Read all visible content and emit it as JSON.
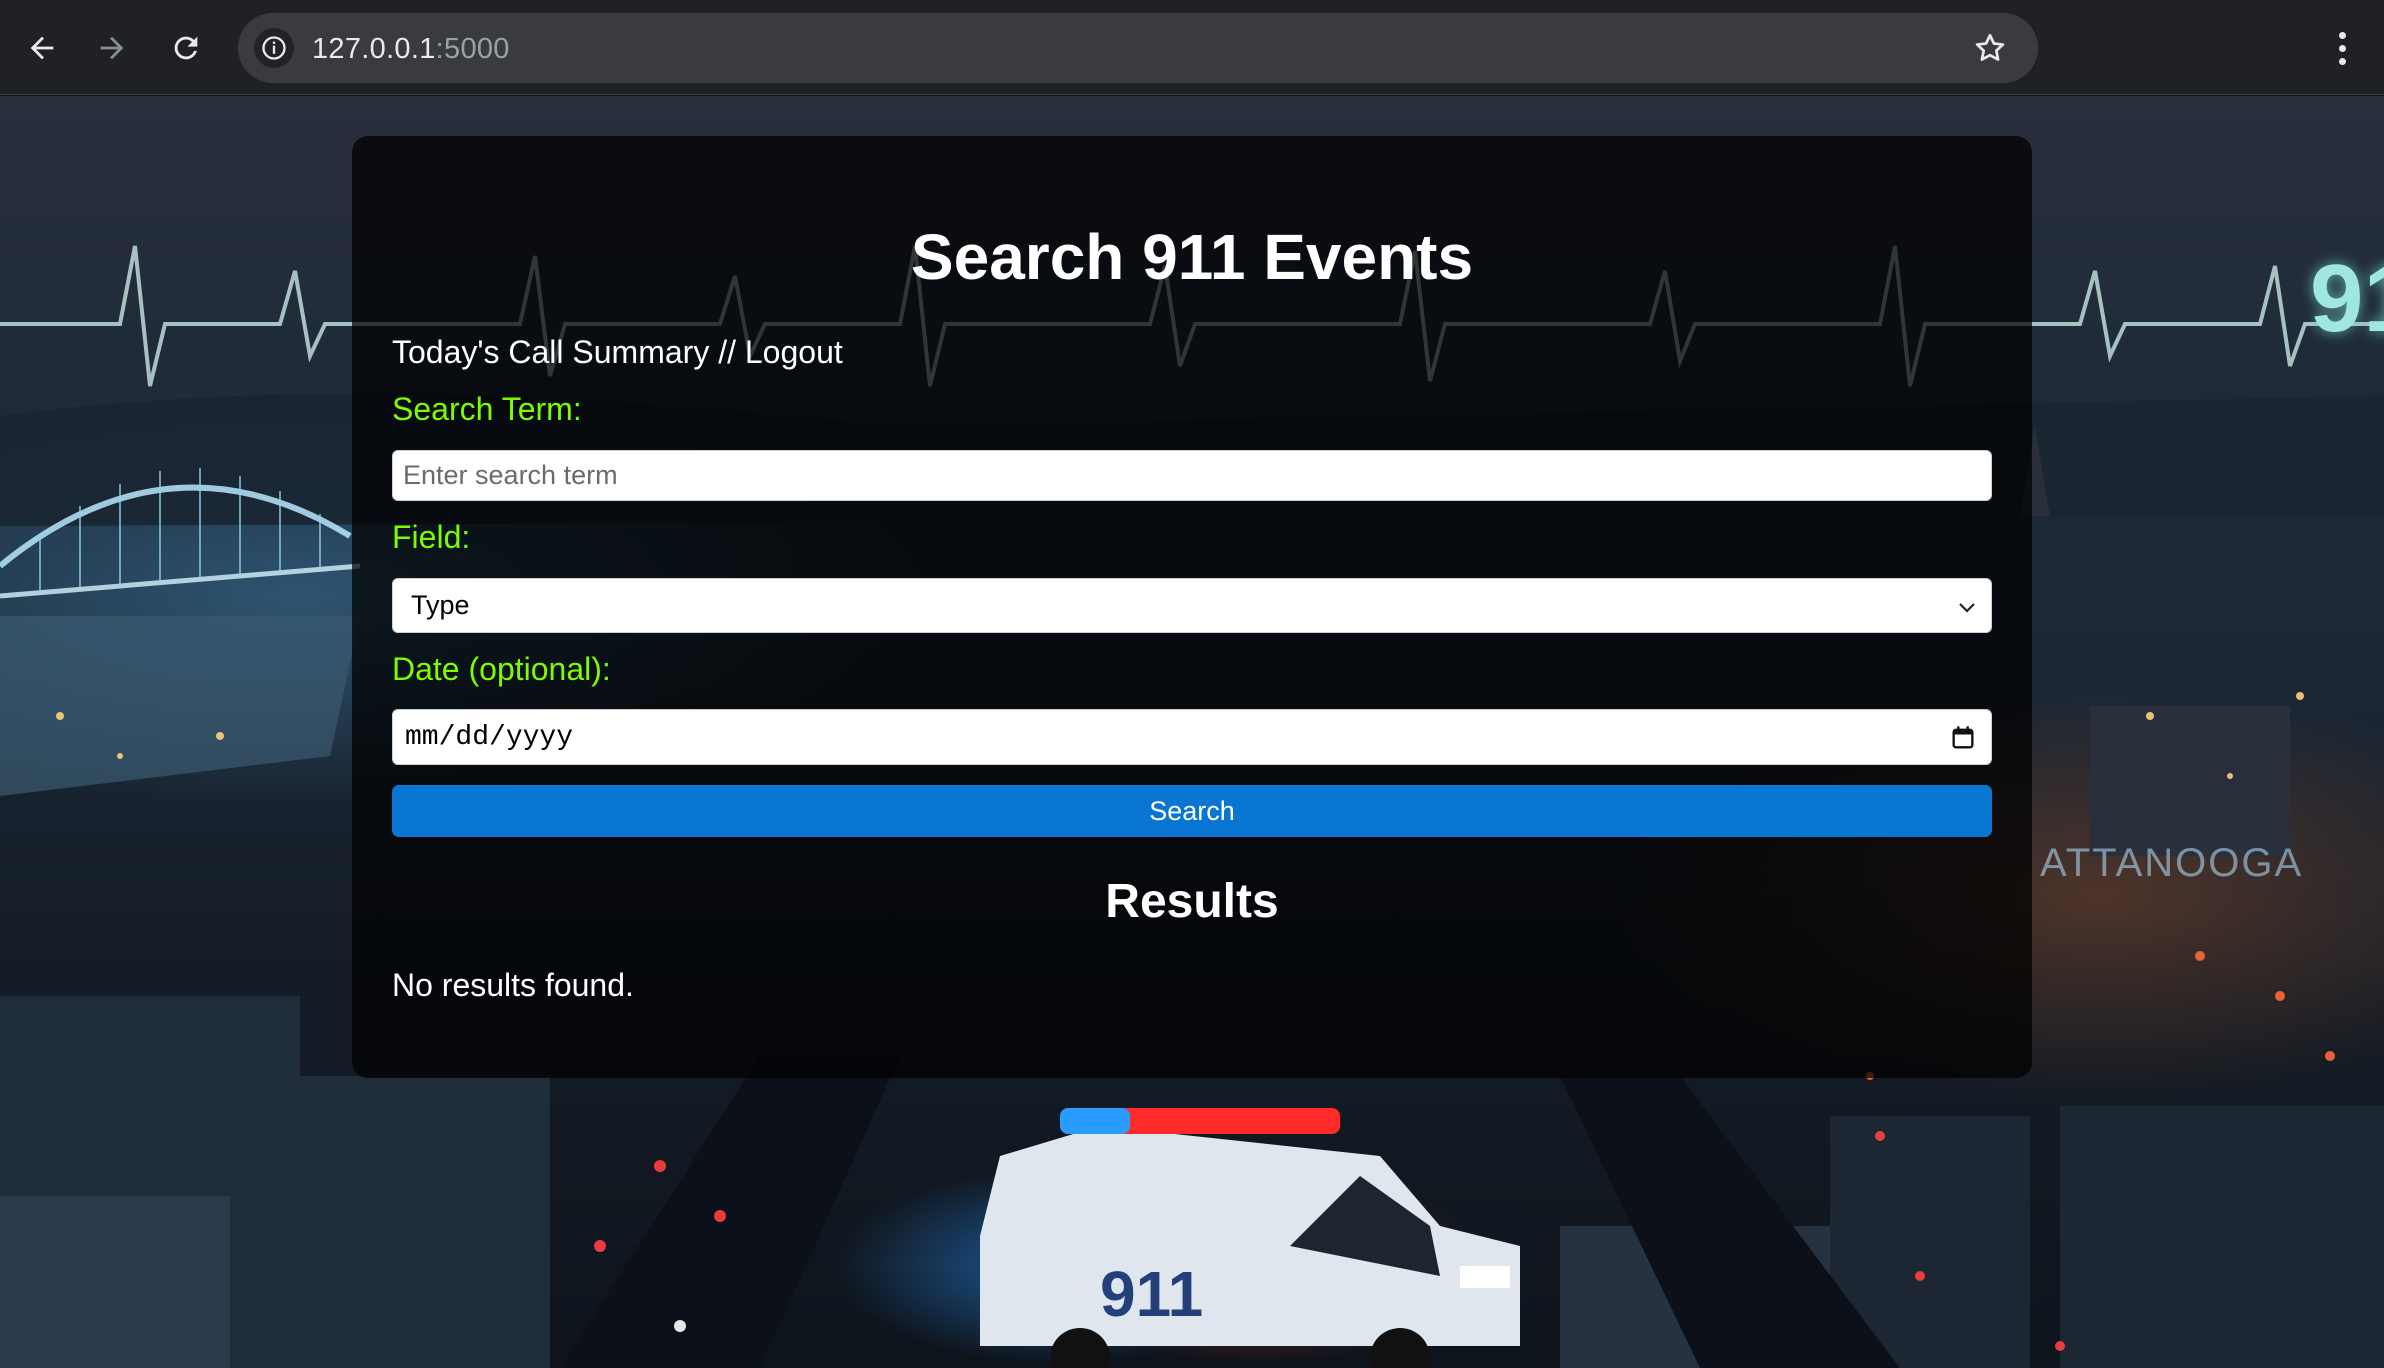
{
  "browser": {
    "url_host": "127.0.0.1",
    "url_port": ":5000"
  },
  "background": {
    "corner_text": "91",
    "city_sign": "ATTANOOGA"
  },
  "page": {
    "title": "Search 911 Events",
    "links": {
      "summary": "Today's Call Summary",
      "separator": " // ",
      "logout": "Logout"
    },
    "search_term_label": "Search Term:",
    "search_term_placeholder": "Enter search term",
    "field_label": "Field:",
    "field_selected": "Type",
    "date_label": "Date (optional):",
    "date_placeholder": "mm/dd/yyyy",
    "search_button": "Search",
    "results_heading": "Results",
    "results_message": "No results found."
  },
  "colors": {
    "label_green": "#7cfc00",
    "button_blue": "#0a76d3"
  }
}
